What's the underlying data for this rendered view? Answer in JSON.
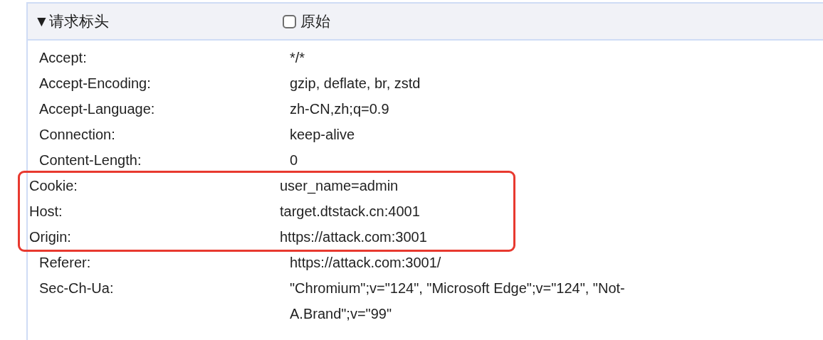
{
  "section": {
    "toggle": "▼",
    "title": "请求标头",
    "expanded": true,
    "raw_toggle": {
      "label": "原始",
      "checked": false
    }
  },
  "headers": [
    {
      "name": "Accept:",
      "value": "*/*",
      "highlighted": false
    },
    {
      "name": "Accept-Encoding:",
      "value": "gzip, deflate, br, zstd",
      "highlighted": false
    },
    {
      "name": "Accept-Language:",
      "value": "zh-CN,zh;q=0.9",
      "highlighted": false
    },
    {
      "name": "Connection:",
      "value": "keep-alive",
      "highlighted": false
    },
    {
      "name": "Content-Length:",
      "value": "0",
      "highlighted": false
    },
    {
      "name": "Cookie:",
      "value": "user_name=admin",
      "highlighted": true
    },
    {
      "name": "Host:",
      "value": "target.dtstack.cn:4001",
      "highlighted": true
    },
    {
      "name": "Origin:",
      "value": "https://attack.com:3001",
      "highlighted": true
    },
    {
      "name": "Referer:",
      "value": "https://attack.com:3001/",
      "highlighted": false
    },
    {
      "name": "Sec-Ch-Ua:",
      "value": "\"Chromium\";v=\"124\", \"Microsoft Edge\";v=\"124\", \"Not-A.Brand\";v=\"99\"",
      "highlighted": false
    }
  ]
}
